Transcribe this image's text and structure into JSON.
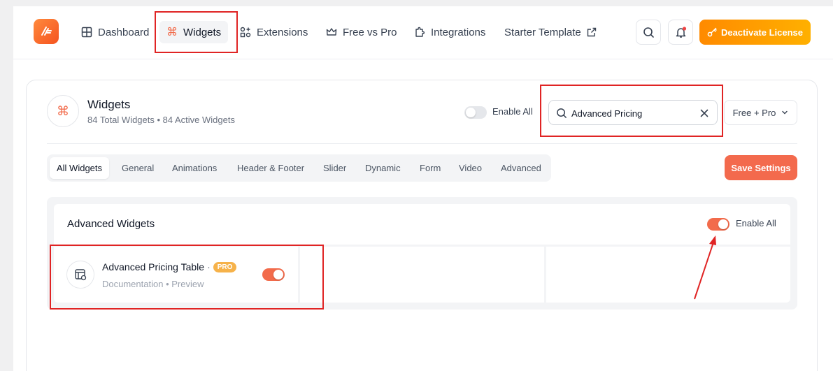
{
  "nav": {
    "items": [
      {
        "label": "Dashboard",
        "icon": "grid-icon"
      },
      {
        "label": "Widgets",
        "icon": "command-icon"
      },
      {
        "label": "Extensions",
        "icon": "shapes-icon"
      },
      {
        "label": "Free vs Pro",
        "icon": "crown-icon"
      },
      {
        "label": "Integrations",
        "icon": "puzzle-icon"
      },
      {
        "label": "Starter Template",
        "icon": "external-link-icon"
      }
    ],
    "active": "Widgets",
    "deactivate_label": "Deactivate License"
  },
  "header": {
    "title": "Widgets",
    "subtitle": "84 Total Widgets • 84 Active Widgets",
    "enable_all_label": "Enable All",
    "enable_all_on": false
  },
  "search": {
    "value": "Advanced Pricing"
  },
  "filter": {
    "selected": "Free + Pro"
  },
  "tabs": [
    "All Widgets",
    "General",
    "Animations",
    "Header & Footer",
    "Slider",
    "Dynamic",
    "Form",
    "Video",
    "Advanced"
  ],
  "active_tab": "All Widgets",
  "save_label": "Save Settings",
  "section": {
    "title": "Advanced Widgets",
    "enable_all_label": "Enable All",
    "enable_all_on": true
  },
  "widget": {
    "name": "Advanced Pricing Table",
    "separator": "·",
    "badge": "PRO",
    "doc_link": "Documentation",
    "links_separator": "•",
    "preview_link": "Preview",
    "enabled": true
  },
  "colors": {
    "accent": "#f26b4b",
    "license_button": "#ff9a00",
    "annotation": "#e02424"
  }
}
